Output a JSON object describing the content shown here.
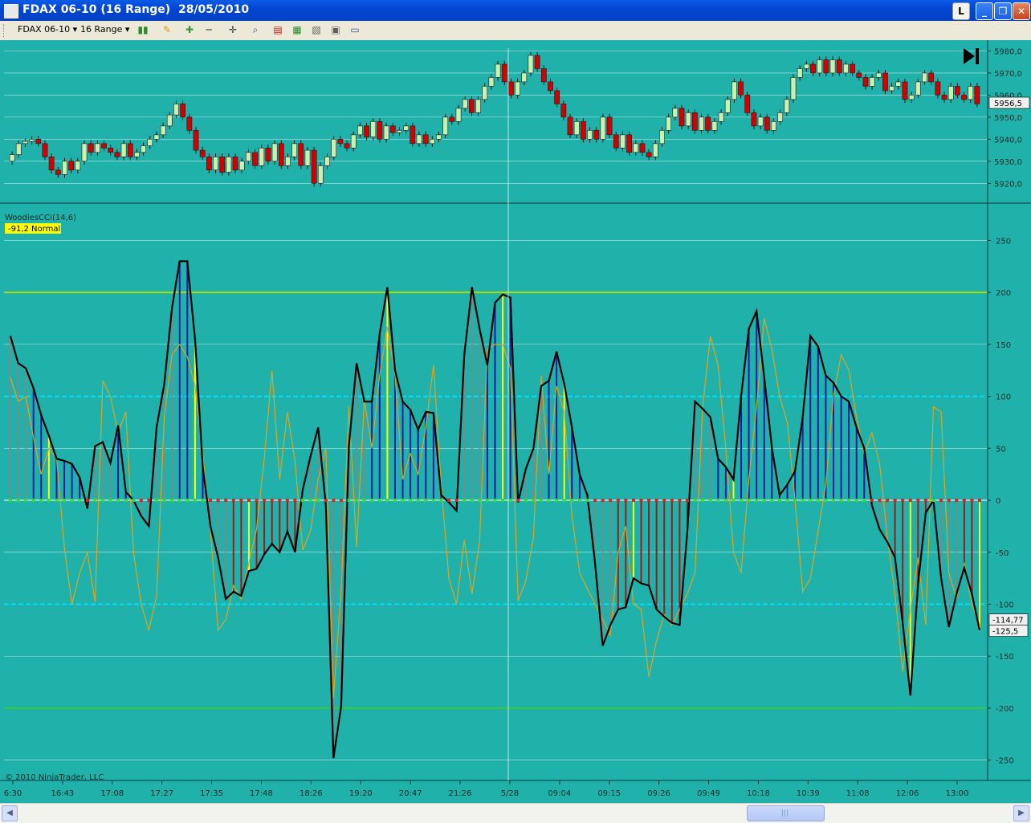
{
  "window": {
    "title": "FDAX 06-10 (16 Range)  28/05/2010",
    "buttons": [
      "L",
      "_",
      "❐",
      "✕"
    ]
  },
  "toolbar": {
    "instrument": "FDAX 06-10",
    "interval": "16 Range",
    "icons": [
      "bar-style-icon",
      "draw-pencil-icon",
      "zoom-in-icon",
      "zoom-out-icon",
      "crosshair-icon",
      "magnifier-icon",
      "data-box-icon",
      "indicators-icon",
      "strategies-icon",
      "properties-icon",
      "window-icon"
    ]
  },
  "colors": {
    "background": "#20b2aa",
    "up_candle": "#c8f0b0",
    "down_candle": "#d40000",
    "cci_line": "#000000",
    "turbo_line": "#daa520",
    "hist_positive": "#1a1aa8",
    "hist_negative": "#a01818",
    "hist_neutral": "#7a8a8a",
    "level_cyan": "#00e0ff",
    "level_200": "#aadd00",
    "level_minus200": "#33cc33"
  },
  "chart_data": [
    {
      "type": "candlestick",
      "series_name": "FDAX 06-10",
      "ylim": [
        5915,
        5982
      ],
      "y_ticks": [
        "5980,0",
        "5970,0",
        "5960,0",
        "5950,0",
        "5940,0",
        "5930,0",
        "5920,0"
      ],
      "y_tick_values": [
        5980,
        5970,
        5960,
        5950,
        5940,
        5930,
        5920
      ],
      "last_price": "5956,5",
      "last_price_value": 5956.5,
      "closes": [
        5933,
        5938,
        5939,
        5940,
        5938,
        5932,
        5926,
        5924,
        5930,
        5926,
        5930,
        5938,
        5934,
        5938,
        5936,
        5934,
        5932,
        5938,
        5932,
        5934,
        5937,
        5940,
        5942,
        5946,
        5951,
        5956,
        5950,
        5944,
        5935,
        5932,
        5926,
        5932,
        5925,
        5932,
        5926,
        5930,
        5934,
        5928,
        5936,
        5930,
        5938,
        5928,
        5932,
        5938,
        5928,
        5935,
        5920,
        5928,
        5932,
        5940,
        5938,
        5936,
        5942,
        5946,
        5941,
        5948,
        5940,
        5946,
        5943,
        5944,
        5946,
        5938,
        5942,
        5938,
        5940,
        5942,
        5950,
        5948,
        5954,
        5958,
        5952,
        5958,
        5964,
        5968,
        5974,
        5966,
        5960,
        5966,
        5970,
        5978,
        5972,
        5966,
        5962,
        5956,
        5950,
        5942,
        5948,
        5940,
        5944,
        5940,
        5950,
        5942,
        5936,
        5942,
        5934,
        5938,
        5934,
        5932,
        5938,
        5944,
        5950,
        5954,
        5946,
        5952,
        5944,
        5950,
        5944,
        5948,
        5952,
        5958,
        5966,
        5960,
        5952,
        5946,
        5950,
        5944,
        5948,
        5952,
        5958,
        5968,
        5972,
        5974,
        5970,
        5976,
        5970,
        5976,
        5970,
        5974,
        5970,
        5968,
        5964,
        5968,
        5970,
        5962,
        5964,
        5966,
        5958,
        5960,
        5966,
        5970,
        5966,
        5960,
        5958,
        5964,
        5960,
        5958,
        5964,
        5956
      ]
    },
    {
      "type": "line",
      "title": "WoodiesCCI(14,6)",
      "readout": "-91,2 Normal",
      "ylim": [
        -268,
        282
      ],
      "y_ticks": [
        "250",
        "200",
        "150",
        "100",
        "50",
        "0",
        "-50",
        "-100",
        "-150",
        "-200",
        "-250"
      ],
      "y_tick_values": [
        250,
        200,
        150,
        100,
        50,
        0,
        -50,
        -100,
        -150,
        -200,
        -250
      ],
      "levels": [
        200,
        100,
        0,
        -100,
        -200
      ],
      "last_values": [
        "-114,77",
        "-125,5"
      ],
      "last_values_numeric": [
        -114.77,
        -125.5
      ],
      "x_ticks": [
        "6:30",
        "16:43",
        "17:08",
        "17:27",
        "17:35",
        "17:48",
        "18:26",
        "19:20",
        "20:47",
        "21:26",
        "5/28",
        "09:04",
        "09:15",
        "09:26",
        "09:49",
        "10:18",
        "10:39",
        "11:08",
        "12:06",
        "13:00"
      ],
      "cci": [
        158,
        132,
        127,
        108,
        82,
        62,
        40,
        38,
        35,
        22,
        -8,
        52,
        56,
        36,
        72,
        8,
        0,
        -15,
        -25,
        70,
        112,
        185,
        230,
        230,
        155,
        32,
        -25,
        -55,
        -95,
        -88,
        -92,
        -68,
        -66,
        -52,
        -42,
        -50,
        -30,
        -50,
        10,
        42,
        70,
        -5,
        -248,
        -198,
        52,
        132,
        95,
        95,
        160,
        205,
        125,
        95,
        87,
        68,
        85,
        84,
        5,
        -2,
        -10,
        140,
        205,
        165,
        130,
        190,
        198,
        195,
        -2,
        30,
        50,
        110,
        115,
        143,
        112,
        70,
        25,
        5,
        -60,
        -140,
        -120,
        -105,
        -103,
        -75,
        -80,
        -82,
        -105,
        -112,
        -118,
        -120,
        -30,
        95,
        88,
        80,
        40,
        32,
        20,
        100,
        165,
        182,
        118,
        50,
        5,
        15,
        28,
        80,
        158,
        148,
        120,
        113,
        100,
        95,
        70,
        50,
        -5,
        -28,
        -40,
        -55,
        -118,
        -188,
        -80,
        -12,
        0,
        -75,
        -122,
        -90,
        -65,
        -90,
        -125
      ],
      "turbo": [
        118,
        95,
        100,
        60,
        25,
        50,
        40,
        -45,
        -100,
        -70,
        -50,
        -98,
        115,
        100,
        65,
        85,
        -50,
        -100,
        -125,
        -92,
        80,
        140,
        150,
        138,
        110,
        45,
        -30,
        -125,
        -115,
        -82,
        -95,
        -60,
        -28,
        40,
        125,
        20,
        85,
        38,
        -48,
        -30,
        20,
        50,
        -190,
        -85,
        90,
        -45,
        96,
        50,
        120,
        167,
        120,
        20,
        45,
        25,
        70,
        130,
        15,
        -75,
        -100,
        -38,
        -90,
        -40,
        145,
        150,
        150,
        127,
        -97,
        -78,
        -35,
        120,
        25,
        110,
        85,
        -15,
        -70,
        -85,
        -100,
        -115,
        -130,
        -50,
        -25,
        -100,
        -105,
        -170,
        -135,
        -110,
        -120,
        -105,
        -90,
        -70,
        90,
        158,
        130,
        50,
        -50,
        -70,
        20,
        90,
        175,
        145,
        100,
        75,
        0,
        -88,
        -75,
        -30,
        15,
        100,
        140,
        125,
        80,
        45,
        65,
        35,
        -35,
        -90,
        -165,
        -105,
        -55,
        -120,
        90,
        85,
        -70,
        -95,
        -60,
        -100,
        -120
      ]
    }
  ],
  "footer": {
    "copyright": "© 2010 NinjaTrader, LLC"
  }
}
